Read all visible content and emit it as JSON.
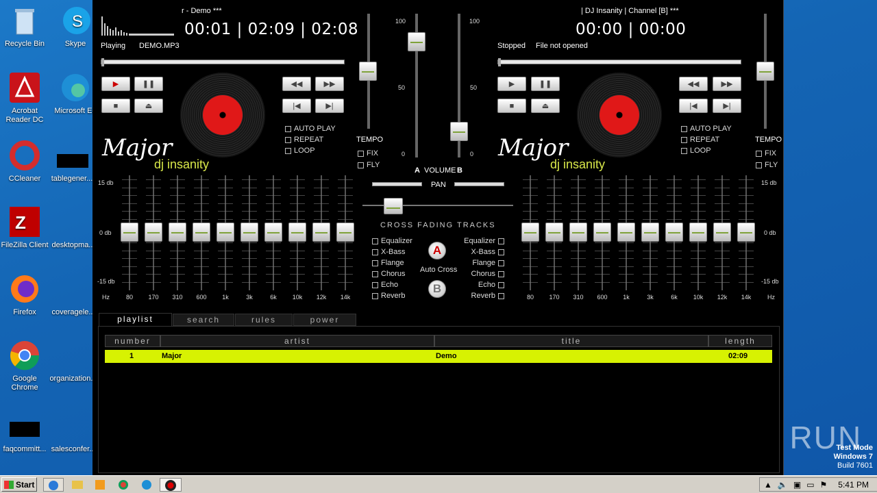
{
  "desktop": {
    "icons": [
      {
        "label": "Recycle Bin",
        "icon": "recycle-bin-icon"
      },
      {
        "label": "Skype",
        "icon": "skype-icon"
      },
      {
        "label": "Acrobat Reader DC",
        "icon": "acrobat-icon"
      },
      {
        "label": "Microsoft Ed",
        "icon": "edge-icon"
      },
      {
        "label": "CCleaner",
        "icon": "ccleaner-icon"
      },
      {
        "label": "tablegener...",
        "icon": "file-icon"
      },
      {
        "label": "FileZilla Client",
        "icon": "filezilla-icon"
      },
      {
        "label": "desktopma...",
        "icon": "file-icon"
      },
      {
        "label": "Firefox",
        "icon": "firefox-icon"
      },
      {
        "label": "coveragele...",
        "icon": "file-icon"
      },
      {
        "label": "Google Chrome",
        "icon": "chrome-icon"
      },
      {
        "label": "organization...",
        "icon": "file-icon"
      },
      {
        "label": "faqcommitt...",
        "icon": "file-icon"
      },
      {
        "label": "salesconfer...",
        "icon": "file-icon"
      }
    ],
    "watermark": "ANY RUN",
    "test_mode": [
      "Test Mode",
      "Windows 7",
      "Build 7601"
    ]
  },
  "deckA": {
    "title": "r - Demo ***",
    "time": "00:01 | 02:09 | 02:08",
    "status": "Playing",
    "file": "DEMO.MP3",
    "progress": 0.01,
    "autoplay": "AUTO PLAY",
    "repeat": "REPEAT",
    "loop": "LOOP",
    "tempo": "TEMPO",
    "fix": "FIX",
    "fly": "FLY"
  },
  "deckB": {
    "title": "| DJ Insanity | Channel [B] ***",
    "time": "00:00 | 00:00",
    "status": "Stopped",
    "file": "File not opened",
    "progress": 0.0,
    "autoplay": "AUTO PLAY",
    "repeat": "REPEAT",
    "loop": "LOOP",
    "tempo": "TEMPO",
    "fix": "FIX",
    "fly": "FLY"
  },
  "logo": {
    "major": "Major",
    "dj": "dj insanity"
  },
  "volume": {
    "label": "VOLUME",
    "a": "A",
    "b": "B",
    "top": "100",
    "mid": "50",
    "bottom": "0"
  },
  "pan": "PAN",
  "crossfade": "CROSS FADING TRACKS",
  "autocross": "Auto Cross",
  "fx": [
    "Equalizer",
    "X-Bass",
    "Flange",
    "Chorus",
    "Echo",
    "Reverb"
  ],
  "eq": {
    "db_top": "15 db",
    "db_mid": "0 db",
    "db_bot": "-15 db",
    "hz": "Hz",
    "bands": [
      "80",
      "170",
      "310",
      "600",
      "1k",
      "3k",
      "6k",
      "10k",
      "12k",
      "14k"
    ]
  },
  "tabs": [
    "playlist",
    "search",
    "rules",
    "power"
  ],
  "playlist": {
    "columns": [
      "number",
      "artist",
      "title",
      "length"
    ],
    "rows": [
      {
        "number": "1",
        "artist": "Major",
        "title": "Demo",
        "length": "02:09"
      }
    ]
  },
  "taskbar": {
    "start": "Start",
    "clock": "5:41 PM"
  }
}
